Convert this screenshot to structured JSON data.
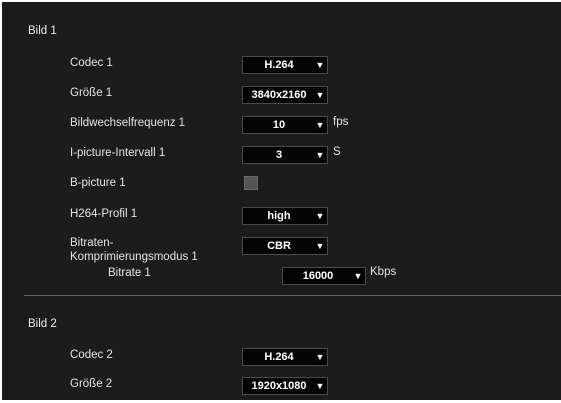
{
  "bild1": {
    "title": "Bild 1",
    "codec": {
      "label": "Codec 1",
      "value": "H.264"
    },
    "groesse": {
      "label": "Größe 1",
      "value": "3840x2160"
    },
    "bildwechsel": {
      "label": "Bildwechselfrequenz 1",
      "value": "10",
      "unit": "fps"
    },
    "ipicture": {
      "label": "I-picture-Intervall 1",
      "value": "3",
      "unit": "S"
    },
    "bpicture": {
      "label": "B-picture 1",
      "checked": false
    },
    "profil": {
      "label": "H264-Profil 1",
      "value": "high"
    },
    "bitratenmodus": {
      "label_line1": "Bitraten-",
      "label_line2": "Komprimierungsmodus 1",
      "value": "CBR"
    },
    "bitrate": {
      "label": "Bitrate 1",
      "value": "16000",
      "unit": "Kbps"
    }
  },
  "bild2": {
    "title": "Bild 2",
    "codec": {
      "label": "Codec 2",
      "value": "H.264"
    },
    "groesse": {
      "label": "Größe 2",
      "value": "1920x1080"
    }
  },
  "icons": {
    "dropdown": "triangle-down-icon"
  },
  "colors": {
    "background": "#1c1c1c",
    "select_bg": "#050505",
    "divider": "#5c5c5c"
  }
}
